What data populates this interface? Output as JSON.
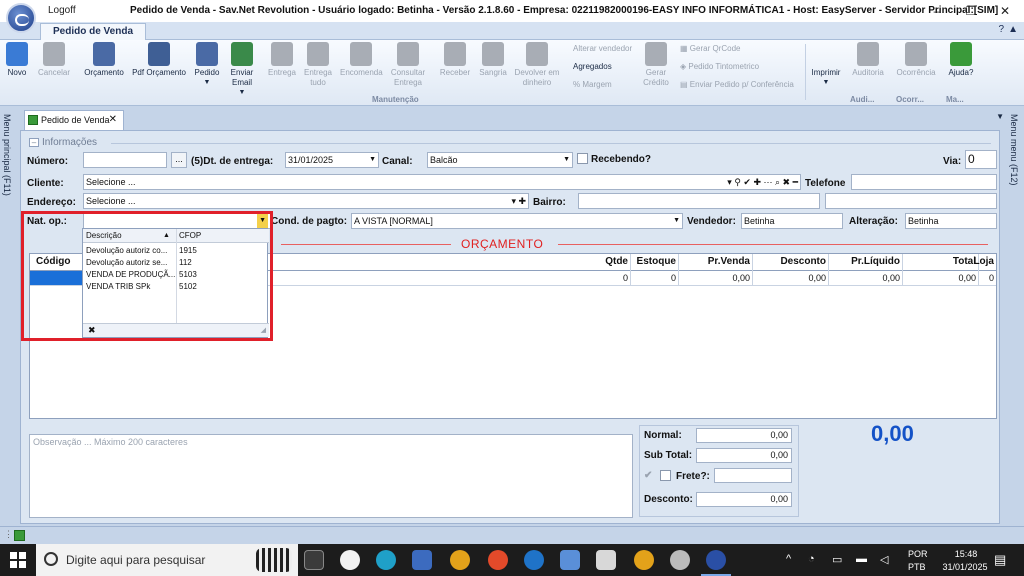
{
  "window": {
    "logoff_label": "Logoff",
    "title": "Pedido de Venda - Sav.Net Revolution - Usuário logado: Betinha - Versão 2.1.8.60 - Empresa: 02211982000196-EASY INFO INFORMÁTICA1 - Host: EasyServer - Servidor Principal:[SIM]",
    "minimize": "–",
    "maximize": "❐",
    "close": "✕"
  },
  "ribbon": {
    "tab": "Pedido de Venda",
    "buttons": [
      {
        "label": "Novo",
        "color": "#3a7bd5",
        "enabled": true
      },
      {
        "label": "Cancelar",
        "color": "#a8adb5",
        "enabled": false
      },
      {
        "label": "Orçamento",
        "color": "#4a6aa5",
        "enabled": true
      },
      {
        "label": "Pdf Orçamento",
        "color": "#3f5f95",
        "enabled": true
      },
      {
        "label": "Pedido",
        "color": "#4a6aa5",
        "enabled": true,
        "dropdown": true
      },
      {
        "label": "Enviar Email",
        "color": "#3a8a4a",
        "enabled": true,
        "dropdown": true
      },
      {
        "label": "Entrega",
        "color": "#a8adb5",
        "enabled": false
      },
      {
        "label": "Entrega tudo",
        "color": "#a8adb5",
        "enabled": false
      },
      {
        "label": "Encomenda",
        "color": "#a8adb5",
        "enabled": false
      },
      {
        "label": "Consultar Entrega",
        "color": "#a8adb5",
        "enabled": false
      },
      {
        "label": "Receber",
        "color": "#a8adb5",
        "enabled": false
      },
      {
        "label": "Sangria",
        "color": "#a8adb5",
        "enabled": false
      },
      {
        "label": "Devolver em dinheiro",
        "color": "#a8adb5",
        "enabled": false
      }
    ],
    "small_buttons": {
      "alterar_vendedor": "Alterar vendedor",
      "agregados": "Agregados",
      "margem": "% Margem",
      "gerar_credito": "Gerar Crédito",
      "gerar_qrcode": "Gerar QrCode",
      "pedido_tintometrico": "Pedido Tintometrico",
      "enviar_conferencia": "Enviar Pedido p/ Conferência"
    },
    "right_buttons": [
      {
        "label": "Imprimir",
        "enabled": true,
        "dropdown": true
      },
      {
        "label": "Auditoria",
        "enabled": false
      },
      {
        "label": "Ocorrência",
        "enabled": false
      },
      {
        "label": "Ajuda?",
        "enabled": true
      }
    ],
    "groups": {
      "manutencao": "Manutenção",
      "audi": "Audi...",
      "ocorr": "Ocorr...",
      "ma": "Ma..."
    }
  },
  "side": {
    "left": "Menu principal (F11)",
    "right": "Menu menu (F12)"
  },
  "doc_tab": {
    "label": "Pedido de Venda",
    "close": "✕"
  },
  "form": {
    "section": "Informações",
    "numero_label": "Número:",
    "numero_value": "",
    "dots": "...",
    "dt_entrega_label": "(5)Dt. de entrega:",
    "dt_entrega_value": "31/01/2025",
    "canal_label": "Canal:",
    "canal_value": "Balcão",
    "recebendo_label": "Recebendo?",
    "via_label": "Via:",
    "via_value": "0",
    "cliente_label": "Cliente:",
    "cliente_value": "Selecione ...",
    "cliente_icons": "▾ ⚲ ✔ ✚ ⋯ ⌕ ✖ ━",
    "telefone_label": "Telefone",
    "telefone_value": "",
    "endereco_label": "Endereço:",
    "endereco_value": "Selecione ...",
    "endereco_icons": "▾ ✚",
    "bairro_label": "Bairro:",
    "bairro_value": "",
    "natop_label": "Nat. op.:",
    "natop_value": "",
    "cond_label": "Cond. de pagto:",
    "cond_value": "A VISTA [NORMAL]",
    "vendedor_label": "Vendedor:",
    "vendedor_value": "Betinha",
    "alteracao_label": "Alteração:",
    "alteracao_value": "Betinha",
    "orcamento_banner": "ORÇAMENTO"
  },
  "grid": {
    "columns": [
      {
        "label": "Código",
        "align": "left"
      },
      {
        "label": "Qtde",
        "align": "right"
      },
      {
        "label": "Estoque",
        "align": "right"
      },
      {
        "label": "Pr.Venda",
        "align": "right"
      },
      {
        "label": "Desconto",
        "align": "right"
      },
      {
        "label": "Pr.Líquido",
        "align": "right"
      },
      {
        "label": "Total",
        "align": "right"
      },
      {
        "label": "Loja",
        "align": "right"
      }
    ],
    "totals_row": [
      "",
      "0",
      "0",
      "0,00",
      "0,00",
      "0,00",
      "0,00",
      "0"
    ]
  },
  "natop_dropdown": {
    "headers": [
      "Descrição",
      "CFOP"
    ],
    "rows": [
      {
        "descricao": "Devolução autoriz co...",
        "cfop": "1915"
      },
      {
        "descricao": "Devolução autoriz se...",
        "cfop": "112"
      },
      {
        "descricao": "VENDA DE PRODUÇÃ...",
        "cfop": "5103"
      },
      {
        "descricao": "VENDA TRIB SPk",
        "cfop": "5102"
      }
    ],
    "clear": "✖"
  },
  "observacao": {
    "placeholder": "Observação ... Máximo 200 caracteres"
  },
  "totals": {
    "normal_label": "Normal:",
    "normal_value": "0,00",
    "subtotal_label": "Sub Total:",
    "subtotal_value": "0,00",
    "frete_label": "Frete?:",
    "frete_value": "",
    "desconto_label": "Desconto:",
    "desconto_value": "0,00",
    "grand_total": "0,00"
  },
  "taskbar": {
    "search_placeholder": "Digite aqui para pesquisar",
    "lang1": "POR",
    "lang2": "PTB",
    "time": "15:48",
    "date": "31/01/2025"
  },
  "colors": {
    "accent_blue": "#1452c7",
    "banner_red": "#e02020",
    "highlight_red": "#e0202a"
  }
}
